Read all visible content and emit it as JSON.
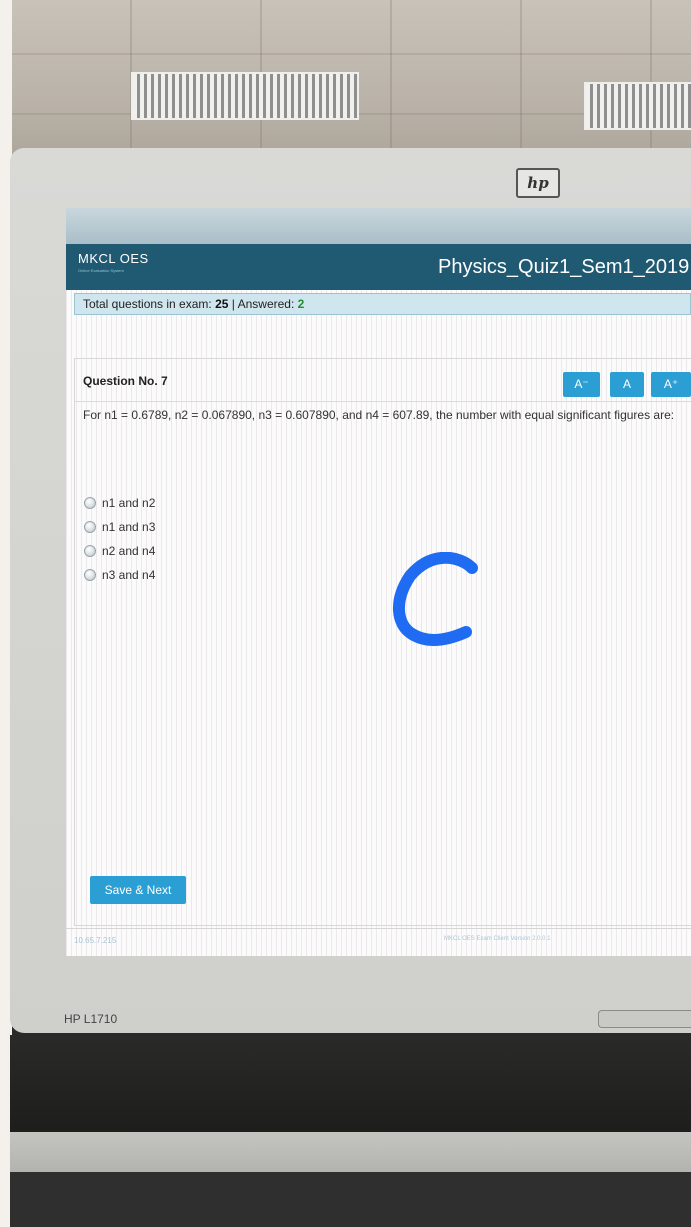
{
  "app": {
    "brand": "MKCL OES",
    "brand_subtitle": "Online Evaluation System",
    "exam_title": "Physics_Quiz1_Sem1_2019"
  },
  "status": {
    "total_label": "Total questions in exam:",
    "total_value": "25",
    "separator": "|",
    "answered_label": "Answered:",
    "answered_value": "2"
  },
  "question": {
    "number_label": "Question No. 7",
    "text": "For n1 = 0.6789, n2 = 0.067890, n3 = 0.607890, and n4 = 607.89, the number with equal significant figures are:",
    "options": [
      {
        "label": "n1 and n2"
      },
      {
        "label": "n1 and n3"
      },
      {
        "label": "n2 and n4"
      },
      {
        "label": "n3 and n4"
      }
    ]
  },
  "font_controls": {
    "decrease": "A⁻",
    "reset": "A",
    "increase": "A⁺"
  },
  "actions": {
    "save_next": "Save & Next"
  },
  "footer": {
    "ip": "10.65.7.215",
    "version": "MKCL OES Exam Client Version 2.0.0.1"
  },
  "hardware": {
    "brand_logo": "hp",
    "model": "HP L1710"
  },
  "colors": {
    "header_bg": "#1f5a72",
    "accent_button": "#2b9fd3",
    "status_bar_bg": "#cfe6ee",
    "answered_green": "#1f8f2e",
    "handwritten_mark": "#1f6cf2"
  },
  "icons": [
    "radio-unselected-icon",
    "hp-logo-icon"
  ]
}
